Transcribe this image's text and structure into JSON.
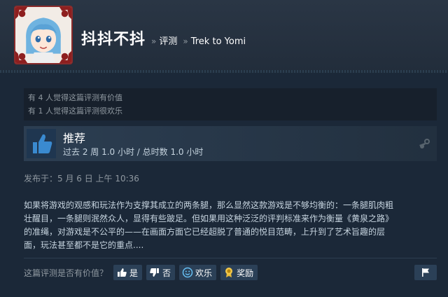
{
  "header": {
    "user_name": "抖抖不抖",
    "crumb_sep_1": "»",
    "crumb_reviews": "评测",
    "crumb_sep_2": "»",
    "crumb_game": "Trek to Yomi"
  },
  "helpful": {
    "line_1": "有 4 人觉得这篇评测有价值",
    "line_2": "有 1 人觉得这篇评测很欢乐"
  },
  "verdict": {
    "title": "推荐",
    "hours": "过去 2 周 1.0 小时 / 总时数 1.0 小时",
    "icons": [
      "thumbs-up-icon",
      "steam-icon"
    ]
  },
  "posted": "发布于：5 月 6 日 上午 10:36",
  "review_lines": [
    "如果将游戏的观感和玩法作为支撑其成立的两条腿，那么显然这款游戏是不够均衡的：一条腿肌肉粗",
    "壮醒目，一条腿则泯然众人，显得有些跛足。但如果用这种泛泛的评判标准来作为衡量《黄泉之路》",
    "的准绳，对游戏是不公平的——在画面方面它已经超脱了普通的悦目范畴，上升到了艺术旨趣的层",
    "面，玩法甚至都不是它的重点...."
  ],
  "vote": {
    "question": "这篇评测是否有价值？",
    "yes": "是",
    "no": "否",
    "funny": "欢乐",
    "award": "奖励",
    "icons": [
      "thumbs-up-icon",
      "thumbs-down-icon",
      "smile-icon",
      "award-icon",
      "flag-icon"
    ]
  },
  "colors": {
    "background": "#1b2838",
    "header": "#252f3d",
    "button": "#2b4057",
    "thumb": "#3a8ad0"
  }
}
